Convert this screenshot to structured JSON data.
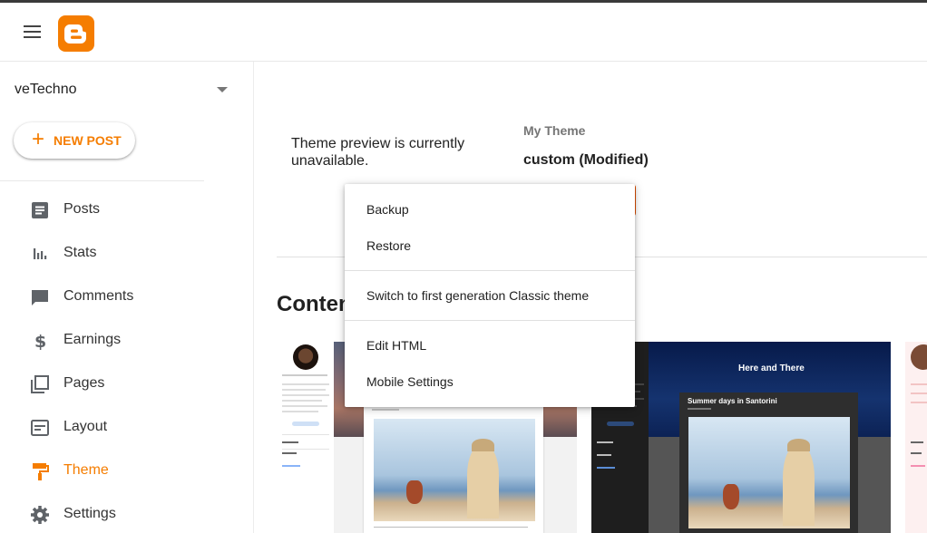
{
  "header": {
    "menu_icon": "hamburger-menu-icon",
    "logo_icon": "blogger-logo-icon",
    "brand_color": "#f57d00"
  },
  "sidebar": {
    "blog_name": "veTechno",
    "new_post_label": "NEW POST",
    "items": [
      {
        "label": "Posts",
        "icon": "posts-icon"
      },
      {
        "label": "Stats",
        "icon": "stats-icon"
      },
      {
        "label": "Comments",
        "icon": "comments-icon"
      },
      {
        "label": "Earnings",
        "icon": "dollar-icon"
      },
      {
        "label": "Pages",
        "icon": "pages-icon"
      },
      {
        "label": "Layout",
        "icon": "layout-icon"
      },
      {
        "label": "Theme",
        "icon": "theme-paint-roller-icon",
        "active": true
      },
      {
        "label": "Settings",
        "icon": "gear-icon"
      }
    ]
  },
  "main": {
    "preview_message": "Theme preview is currently unavailable.",
    "my_theme_label": "My Theme",
    "theme_name": "custom (Modified)",
    "content_heading": "Conten"
  },
  "theme_cards": [
    {
      "name": "light-theme"
    },
    {
      "name": "dark-theme",
      "hero_title": "Here and There",
      "post_title": "Summer days in Santorini"
    },
    {
      "name": "pink-theme"
    }
  ],
  "context_menu": {
    "items": [
      {
        "label": "Backup"
      },
      {
        "label": "Restore"
      },
      {
        "label": "Switch to first generation Classic theme"
      },
      {
        "label": "Edit HTML"
      },
      {
        "label": "Mobile Settings"
      }
    ]
  }
}
